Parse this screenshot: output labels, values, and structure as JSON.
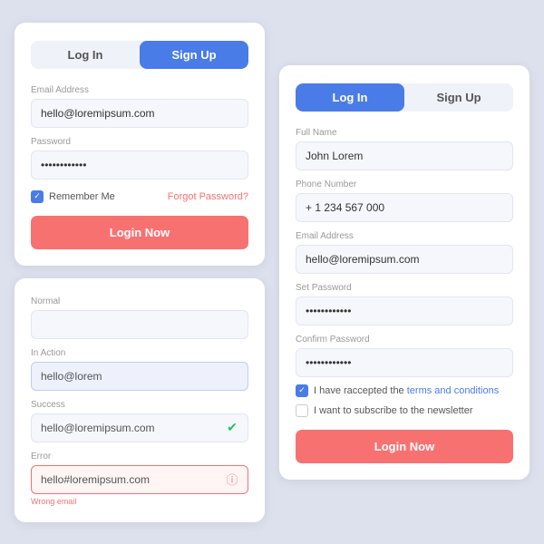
{
  "leftCard": {
    "tab1": "Log In",
    "tab2": "Sign Up",
    "tab1Active": true,
    "emailLabel": "Email Address",
    "emailValue": "hello@loremipsum.com",
    "passwordLabel": "Password",
    "passwordValue": "••••••••••••",
    "rememberLabel": "Remember Me",
    "forgotLabel": "Forgot Password?",
    "loginButton": "Login Now"
  },
  "inputStatesCard": {
    "normalLabel": "Normal",
    "normalPlaceholder": "",
    "inActionLabel": "In Action",
    "inActionValue": "hello@lorem",
    "successLabel": "Success",
    "successValue": "hello@loremipsum.com",
    "errorLabel": "Error",
    "errorValue": "hello#loremipsum.com",
    "errorMessage": "Wrong email"
  },
  "rightCard": {
    "tab1": "Log In",
    "tab2": "Sign Up",
    "tab1Active": true,
    "fullNameLabel": "Full Name",
    "fullNameValue": "John Lorem",
    "phoneLabel": "Phone Number",
    "phoneValue": "+ 1 234 567 000",
    "emailLabel": "Email Address",
    "emailValue": "hello@loremipsum.com",
    "setPasswordLabel": "Set Password",
    "setPasswordValue": "••••••••••••",
    "confirmPasswordLabel": "Confirm Password",
    "confirmPasswordValue": "••••••••••••",
    "termsLabel": "I have raccepted the ",
    "termsLink": "terms and conditions",
    "newsletterLabel": "I want to subscribe to the newsletter",
    "loginButton": "Login Now"
  }
}
